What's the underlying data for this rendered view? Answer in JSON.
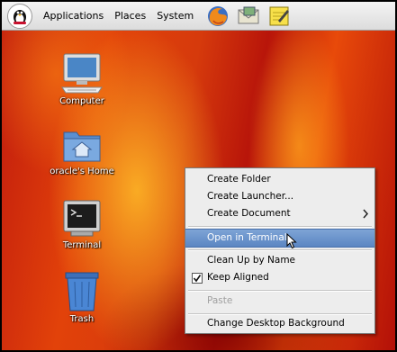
{
  "panel": {
    "menus": [
      {
        "label": "Applications"
      },
      {
        "label": "Places"
      },
      {
        "label": "System"
      }
    ],
    "launchers": [
      {
        "icon": "firefox-icon"
      },
      {
        "icon": "email-icon"
      },
      {
        "icon": "notes-icon"
      }
    ]
  },
  "desktop": {
    "icons": [
      {
        "label": "Computer",
        "icon": "computer-icon"
      },
      {
        "label": "oracle's Home",
        "icon": "home-folder-icon"
      },
      {
        "label": "Terminal",
        "icon": "terminal-icon"
      },
      {
        "label": "Trash",
        "icon": "trash-icon"
      }
    ]
  },
  "context_menu": {
    "items": [
      {
        "label": "Create Folder"
      },
      {
        "label": "Create Launcher..."
      },
      {
        "label": "Create Document",
        "submenu": true
      },
      {
        "label": "Open in Terminal",
        "highlighted": true
      },
      {
        "label": "Clean Up by Name"
      },
      {
        "label": "Keep Aligned",
        "checked": true
      },
      {
        "label": "Paste",
        "disabled": true
      },
      {
        "label": "Change Desktop Background"
      }
    ]
  },
  "colors": {
    "menu_highlight": "#5b86c2",
    "desktop_red": "#c01a0e",
    "desktop_orange": "#ff9a1a"
  }
}
